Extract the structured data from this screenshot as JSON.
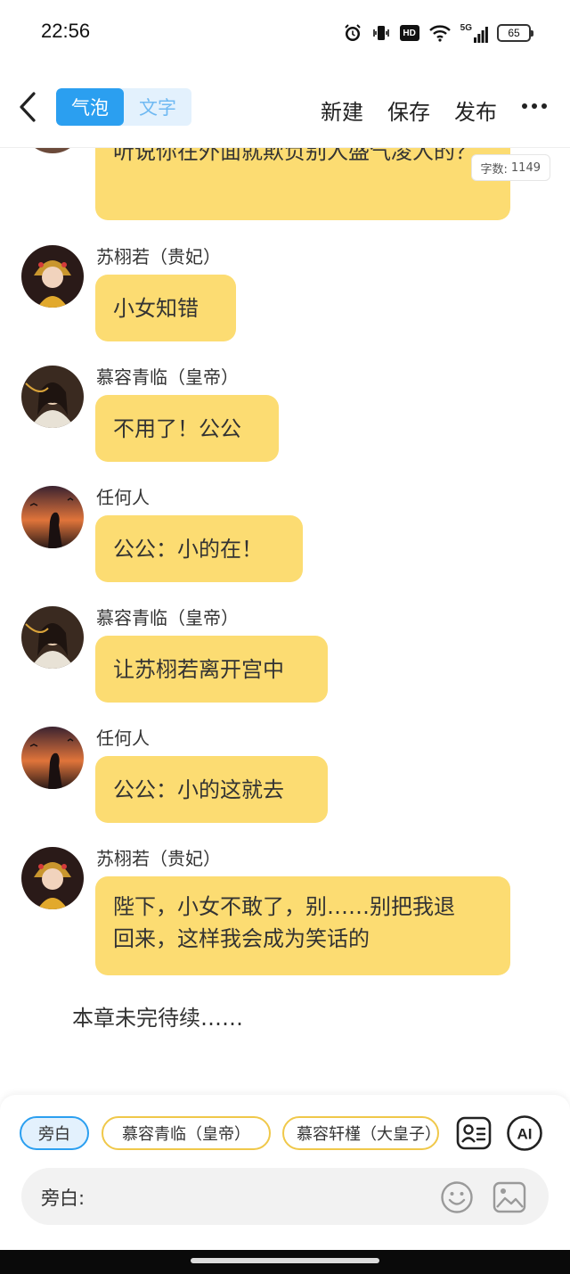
{
  "status_bar": {
    "time": "22:56",
    "icons": [
      "alarm-icon",
      "vibrate-icon",
      "hd-icon",
      "wifi-icon",
      "signal-5g-icon",
      "battery-icon"
    ],
    "hd_label": "HD",
    "network_label": "5G",
    "battery_level": "65"
  },
  "top_bar": {
    "mode_tabs": [
      {
        "label": "气泡",
        "active": true
      },
      {
        "label": "文字",
        "active": false
      }
    ],
    "actions": [
      "新建",
      "保存",
      "发布"
    ]
  },
  "word_count": {
    "label": "字数:",
    "value": "1149"
  },
  "messages": [
    {
      "speaker": "",
      "avatar": "avatar-partial",
      "text": "听说你在外面就欺负别人盛气凌人的？"
    },
    {
      "speaker": "苏栩若（贵妃）",
      "avatar": "consort-avatar",
      "text": "小女知错"
    },
    {
      "speaker": "慕容青临（皇帝）",
      "avatar": "emperor-avatar",
      "text": "不用了！公公"
    },
    {
      "speaker": "任何人",
      "avatar": "silhouette-avatar",
      "text": "公公：小的在！"
    },
    {
      "speaker": "慕容青临（皇帝）",
      "avatar": "emperor-avatar",
      "text": "让苏栩若离开宫中"
    },
    {
      "speaker": "任何人",
      "avatar": "silhouette-avatar",
      "text": "公公：小的这就去"
    },
    {
      "speaker": "苏栩若（贵妃）",
      "avatar": "consort-avatar",
      "text_lines": [
        "陛下，小女不敢了，别……别把我退",
        "回来，这样我会成为笑话的"
      ]
    }
  ],
  "narration": "本章未完待续……",
  "role_chips": [
    {
      "label": "旁白",
      "selected": true
    },
    {
      "label": "慕容青临（皇帝）",
      "selected": false
    },
    {
      "label": "慕容轩槿（大皇子）",
      "selected": false
    }
  ],
  "input": {
    "label": "旁白:",
    "value": "",
    "placeholder": ""
  },
  "colors": {
    "accent_blue": "#2b9ff0",
    "bubble_yellow": "#fcdc72",
    "chip_border": "#f0c84a",
    "toggle_bg": "#e3f1fd"
  }
}
